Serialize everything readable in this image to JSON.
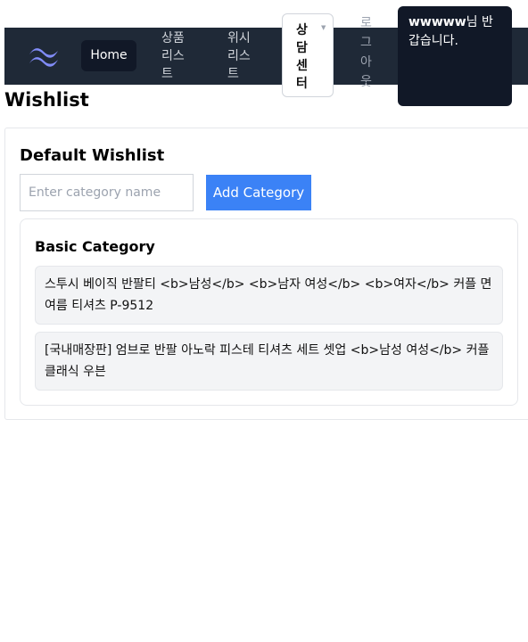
{
  "nav": {
    "home": "Home",
    "product_list": "상품리스트",
    "wishlist": "위시리스트",
    "counsel": "상담센터",
    "logout": "로그아웃"
  },
  "greeting": {
    "username": "wwwww",
    "suffix": "님 반갑습니다."
  },
  "page": {
    "title": "Wishlist"
  },
  "wishlist": {
    "name": "Default Wishlist",
    "input_placeholder": "Enter category name",
    "input_value": "",
    "add_button": "Add Category",
    "category": {
      "name": "Basic Category",
      "items": [
        "스투시 베이직 반팔티 <b>남성</b> <b>남자 여성</b> <b>여자</b> 커플 면 여름 티셔츠 P-9512",
        "[국내매장판] 엄브로 반팔 아노락 피스테 티셔츠 세트 셋업 <b>남성 여성</b> 커플 클래식 우븐"
      ]
    }
  },
  "colors": {
    "navbar": "#1f2937",
    "accent": "#3b82f6",
    "logo": "#818cf8"
  }
}
